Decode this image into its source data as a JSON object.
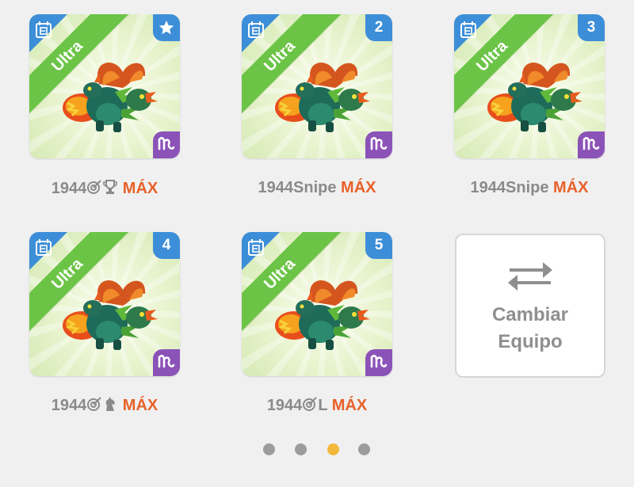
{
  "colors": {
    "max_orange": "#e8612a",
    "ultra_green": "#6cc447",
    "badge_blue": "#3d8ed8",
    "sign_purple": "#8b52b8",
    "page_dot_active": "#f2b83c",
    "page_dot": "#9c9c9c"
  },
  "team_slots": [
    {
      "rarity": "Ultra",
      "rank_badge": "star-icon",
      "name": "1944",
      "name_icons": [
        "target-icon",
        "trophy-icon"
      ],
      "suffix": "",
      "level": "MÁX"
    },
    {
      "rarity": "Ultra",
      "rank_badge": "2",
      "name": "1944Snipe",
      "name_icons": [],
      "suffix": "",
      "level": "MÁX"
    },
    {
      "rarity": "Ultra",
      "rank_badge": "3",
      "name": "1944Snipe",
      "name_icons": [],
      "suffix": "",
      "level": "MÁX"
    },
    {
      "rarity": "Ultra",
      "rank_badge": "4",
      "name": "1944",
      "name_icons": [
        "target-icon",
        "horse-icon"
      ],
      "suffix": "",
      "level": "MÁX"
    },
    {
      "rarity": "Ultra",
      "rank_badge": "5",
      "name": "1944",
      "name_icons": [
        "target-icon"
      ],
      "suffix": "L",
      "level": "MÁX"
    }
  ],
  "change_team": {
    "label": "Cambiar\nEquipo",
    "icon": "swap-arrows-icon"
  },
  "pagination": {
    "total_pages": 4,
    "current_page": 3
  }
}
